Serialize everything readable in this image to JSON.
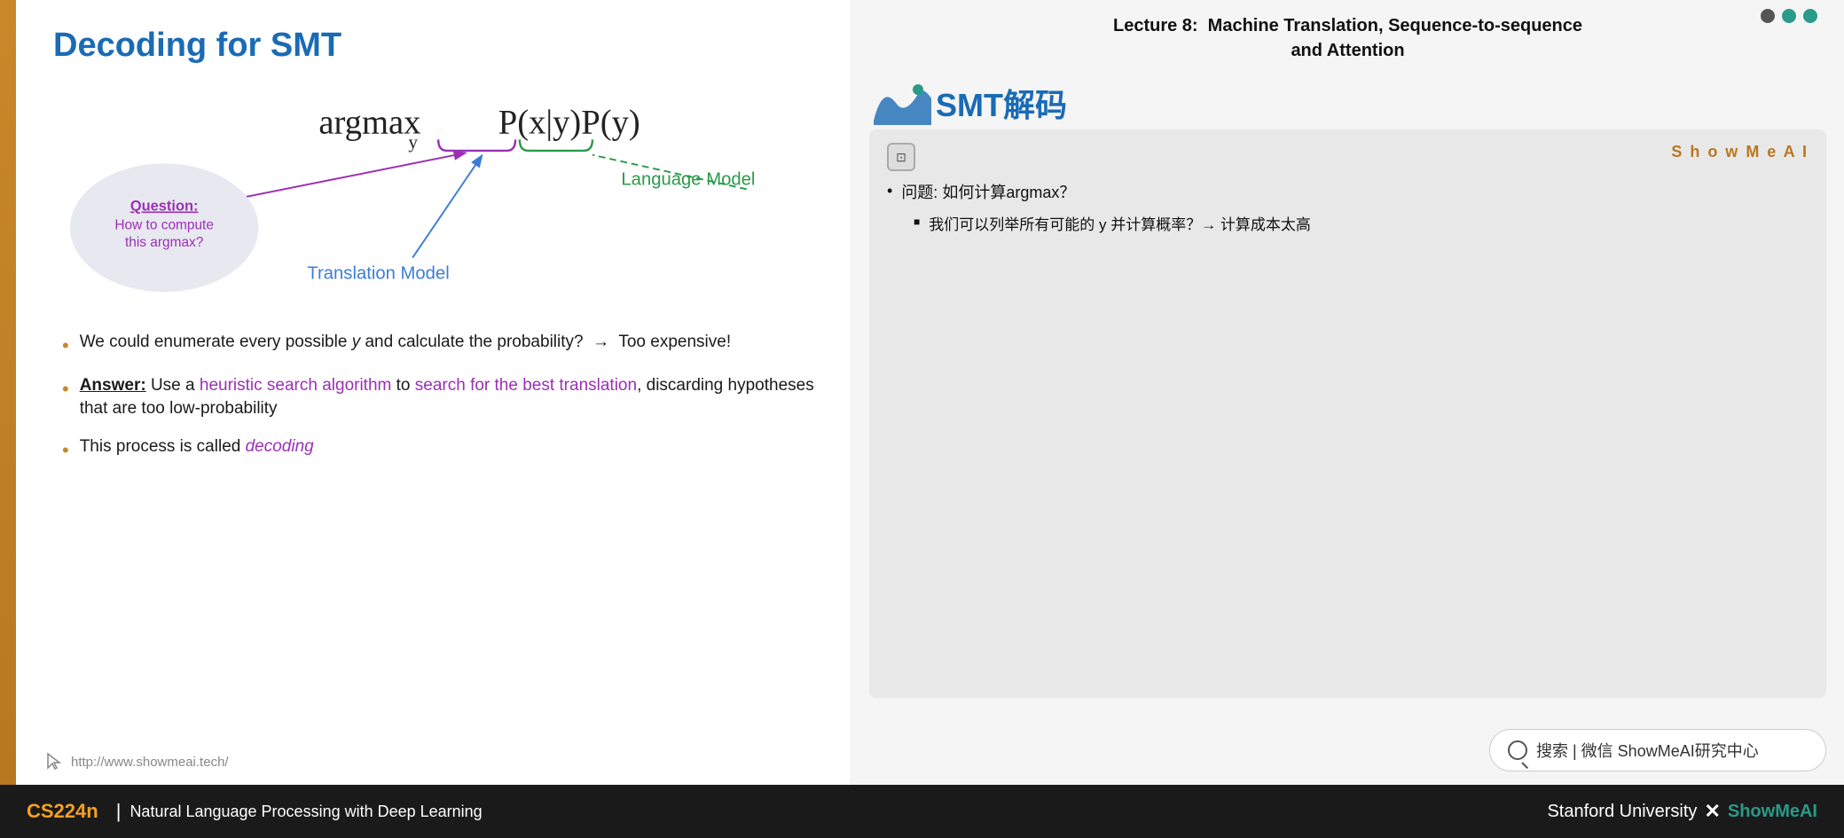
{
  "slide": {
    "title": "Decoding for SMT",
    "formula": "argmax",
    "formula_sub": "y",
    "formula_prob": "P(x|y)P(y)",
    "question_label": "Question:",
    "question_text": "How to compute\nthis argmax?",
    "translation_model_label": "Translation Model",
    "language_model_label": "Language Model",
    "bullets": [
      {
        "text": "We could enumerate every possible y and calculate the probability?  →  Too expensive!"
      },
      {
        "text_answer": "Answer:",
        "text_heuristic": "Use a heuristic search algorithm",
        "text_middle": " to ",
        "text_search": "search for the best translation",
        "text_end": ", discarding hypotheses that are too low-probability"
      },
      {
        "text_start": "This process is called ",
        "text_decoding": "decoding"
      }
    ],
    "url": "http://www.showmeai.tech/"
  },
  "right_panel": {
    "lecture_title": "Lecture 8:  Machine Translation, Sequence-to-sequence\nand Attention",
    "smt_title": "SMT解码",
    "showmeai_label": "S h o w M e A I",
    "ai_icon": "AI",
    "chat_bullet1": "问题: 如何计算argmax？",
    "chat_sub1": "我们可以列举所有可能的 y 并计算概率？→ 计算成本太高",
    "search_bar_text": "搜索 | 微信 ShowMeAI研究中心"
  },
  "footer": {
    "cs224n": "CS224n",
    "separator": "|",
    "subtitle": "Natural Language Processing with Deep Learning",
    "stanford": "Stanford University",
    "x": "✕",
    "showmeai": "ShowMeAI"
  }
}
